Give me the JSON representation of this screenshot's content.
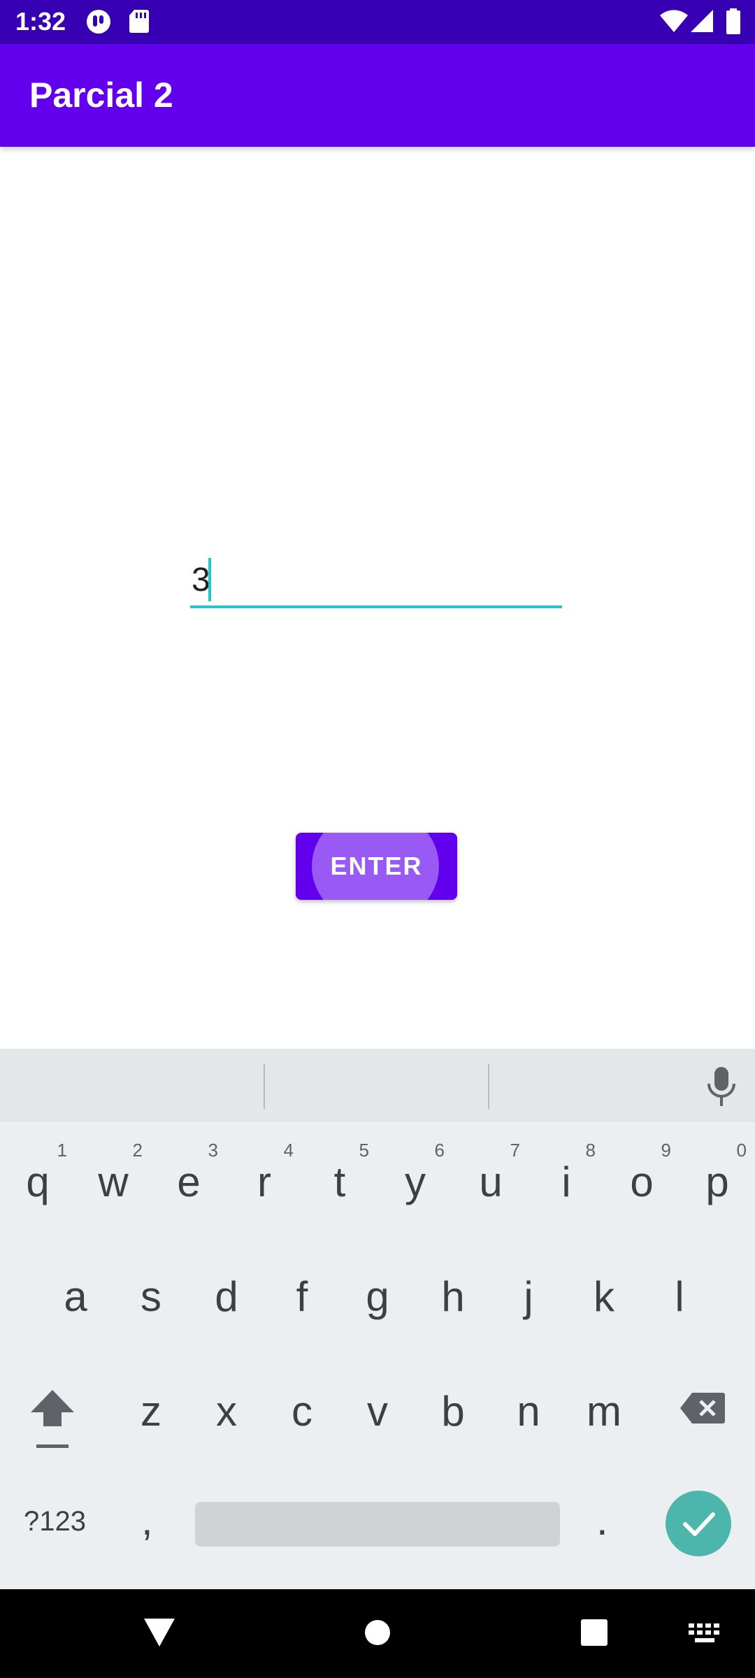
{
  "status_bar": {
    "time": "1:32",
    "icons": [
      "notification-app-icon",
      "sd-card-icon",
      "wifi-icon",
      "cell-signal-icon",
      "battery-icon"
    ]
  },
  "app_bar": {
    "title": "Parcial 2"
  },
  "main": {
    "input": {
      "value": "3"
    },
    "enter_button": {
      "label": "ENTER"
    }
  },
  "keyboard": {
    "row1": [
      {
        "ch": "q",
        "hint": "1"
      },
      {
        "ch": "w",
        "hint": "2"
      },
      {
        "ch": "e",
        "hint": "3"
      },
      {
        "ch": "r",
        "hint": "4"
      },
      {
        "ch": "t",
        "hint": "5"
      },
      {
        "ch": "y",
        "hint": "6"
      },
      {
        "ch": "u",
        "hint": "7"
      },
      {
        "ch": "i",
        "hint": "8"
      },
      {
        "ch": "o",
        "hint": "9"
      },
      {
        "ch": "p",
        "hint": "0"
      }
    ],
    "row2": [
      "a",
      "s",
      "d",
      "f",
      "g",
      "h",
      "j",
      "k",
      "l"
    ],
    "row3": [
      "z",
      "x",
      "c",
      "v",
      "b",
      "n",
      "m"
    ],
    "sym_label": "?123",
    "comma": ",",
    "period": "."
  },
  "colors": {
    "status_bar": "#3700b3",
    "app_bar": "#6200ee",
    "accent": "#26c6c6",
    "keyboard_bg": "#eceff1",
    "done_key": "#4db6ac"
  }
}
